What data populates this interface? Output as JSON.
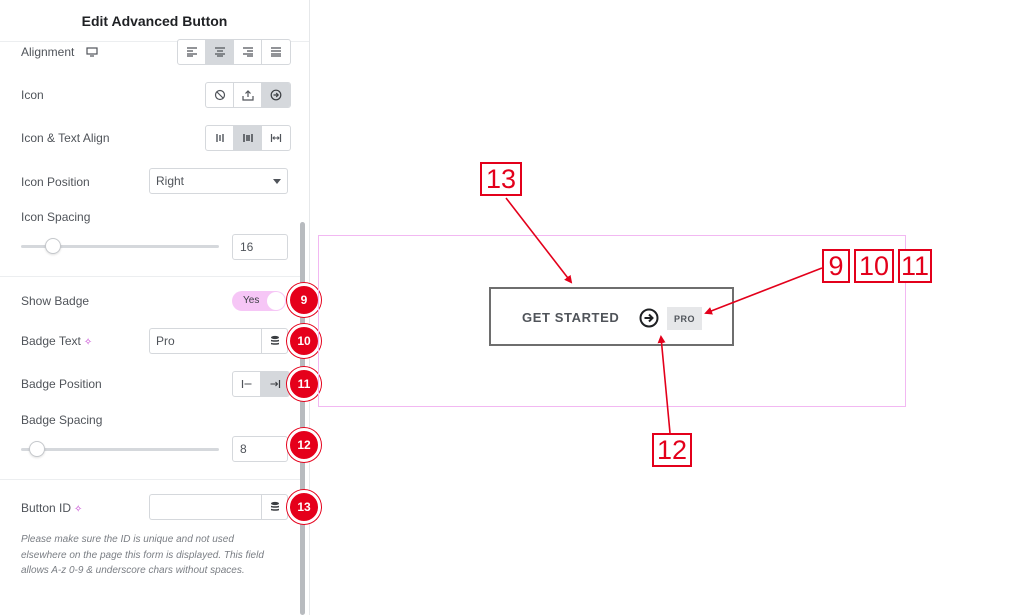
{
  "panel": {
    "title": "Edit Advanced Button",
    "alignment_label": "Alignment",
    "icon_label": "Icon",
    "icon_text_align_label": "Icon & Text Align",
    "icon_position_label": "Icon Position",
    "icon_position_value": "Right",
    "icon_spacing_label": "Icon Spacing",
    "icon_spacing_value": "16",
    "icon_spacing_level": 0.16,
    "show_badge_label": "Show Badge",
    "show_badge_value": "Yes",
    "badge_text_label": "Badge Text",
    "badge_text_value": "Pro",
    "badge_position_label": "Badge Position",
    "badge_spacing_label": "Badge Spacing",
    "badge_spacing_value": "8",
    "badge_spacing_level": 0.08,
    "button_id_label": "Button ID",
    "button_id_value": "",
    "help_text": "Please make sure the ID is unique and not used elsewhere on the page this form is displayed. This field allows A-z  0-9 & underscore chars without spaces."
  },
  "steps": {
    "s9": "9",
    "s10": "10",
    "s11": "11",
    "s12": "12",
    "s13": "13"
  },
  "preview": {
    "button_text": "GET STARTED",
    "badge_text": "PRO"
  },
  "callouts": {
    "c13": "13",
    "c9": "9",
    "c10": "10",
    "c11": "11",
    "c12": "12"
  },
  "colors": {
    "accent_red": "#e5001b",
    "toggle_pink": "#f6c6f6",
    "preview_border": "#f2b8f2"
  }
}
